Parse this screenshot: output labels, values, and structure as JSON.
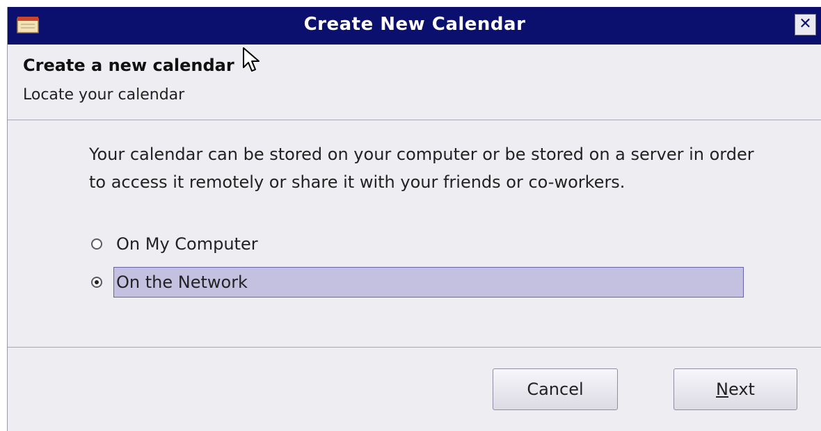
{
  "window": {
    "title": "Create New Calendar",
    "close_label": "✕"
  },
  "header": {
    "title": "Create a new calendar",
    "subtitle": "Locate your calendar"
  },
  "main": {
    "description": "Your calendar can be stored on your computer or be stored on a server in order to access it remotely or share it with your friends or co-workers.",
    "options": [
      {
        "label": "On My Computer",
        "selected": false
      },
      {
        "label": "On the Network",
        "selected": true
      }
    ]
  },
  "buttons": {
    "cancel": "Cancel",
    "next_mnemonic": "N",
    "next_rest": "ext"
  },
  "icons": {
    "app": "calendar-icon",
    "close": "close-icon",
    "cursor": "mouse-pointer-icon"
  },
  "colors": {
    "titlebar": "#0b0f6d",
    "selection": "#c4c0e0",
    "background": "#eeedf1"
  }
}
